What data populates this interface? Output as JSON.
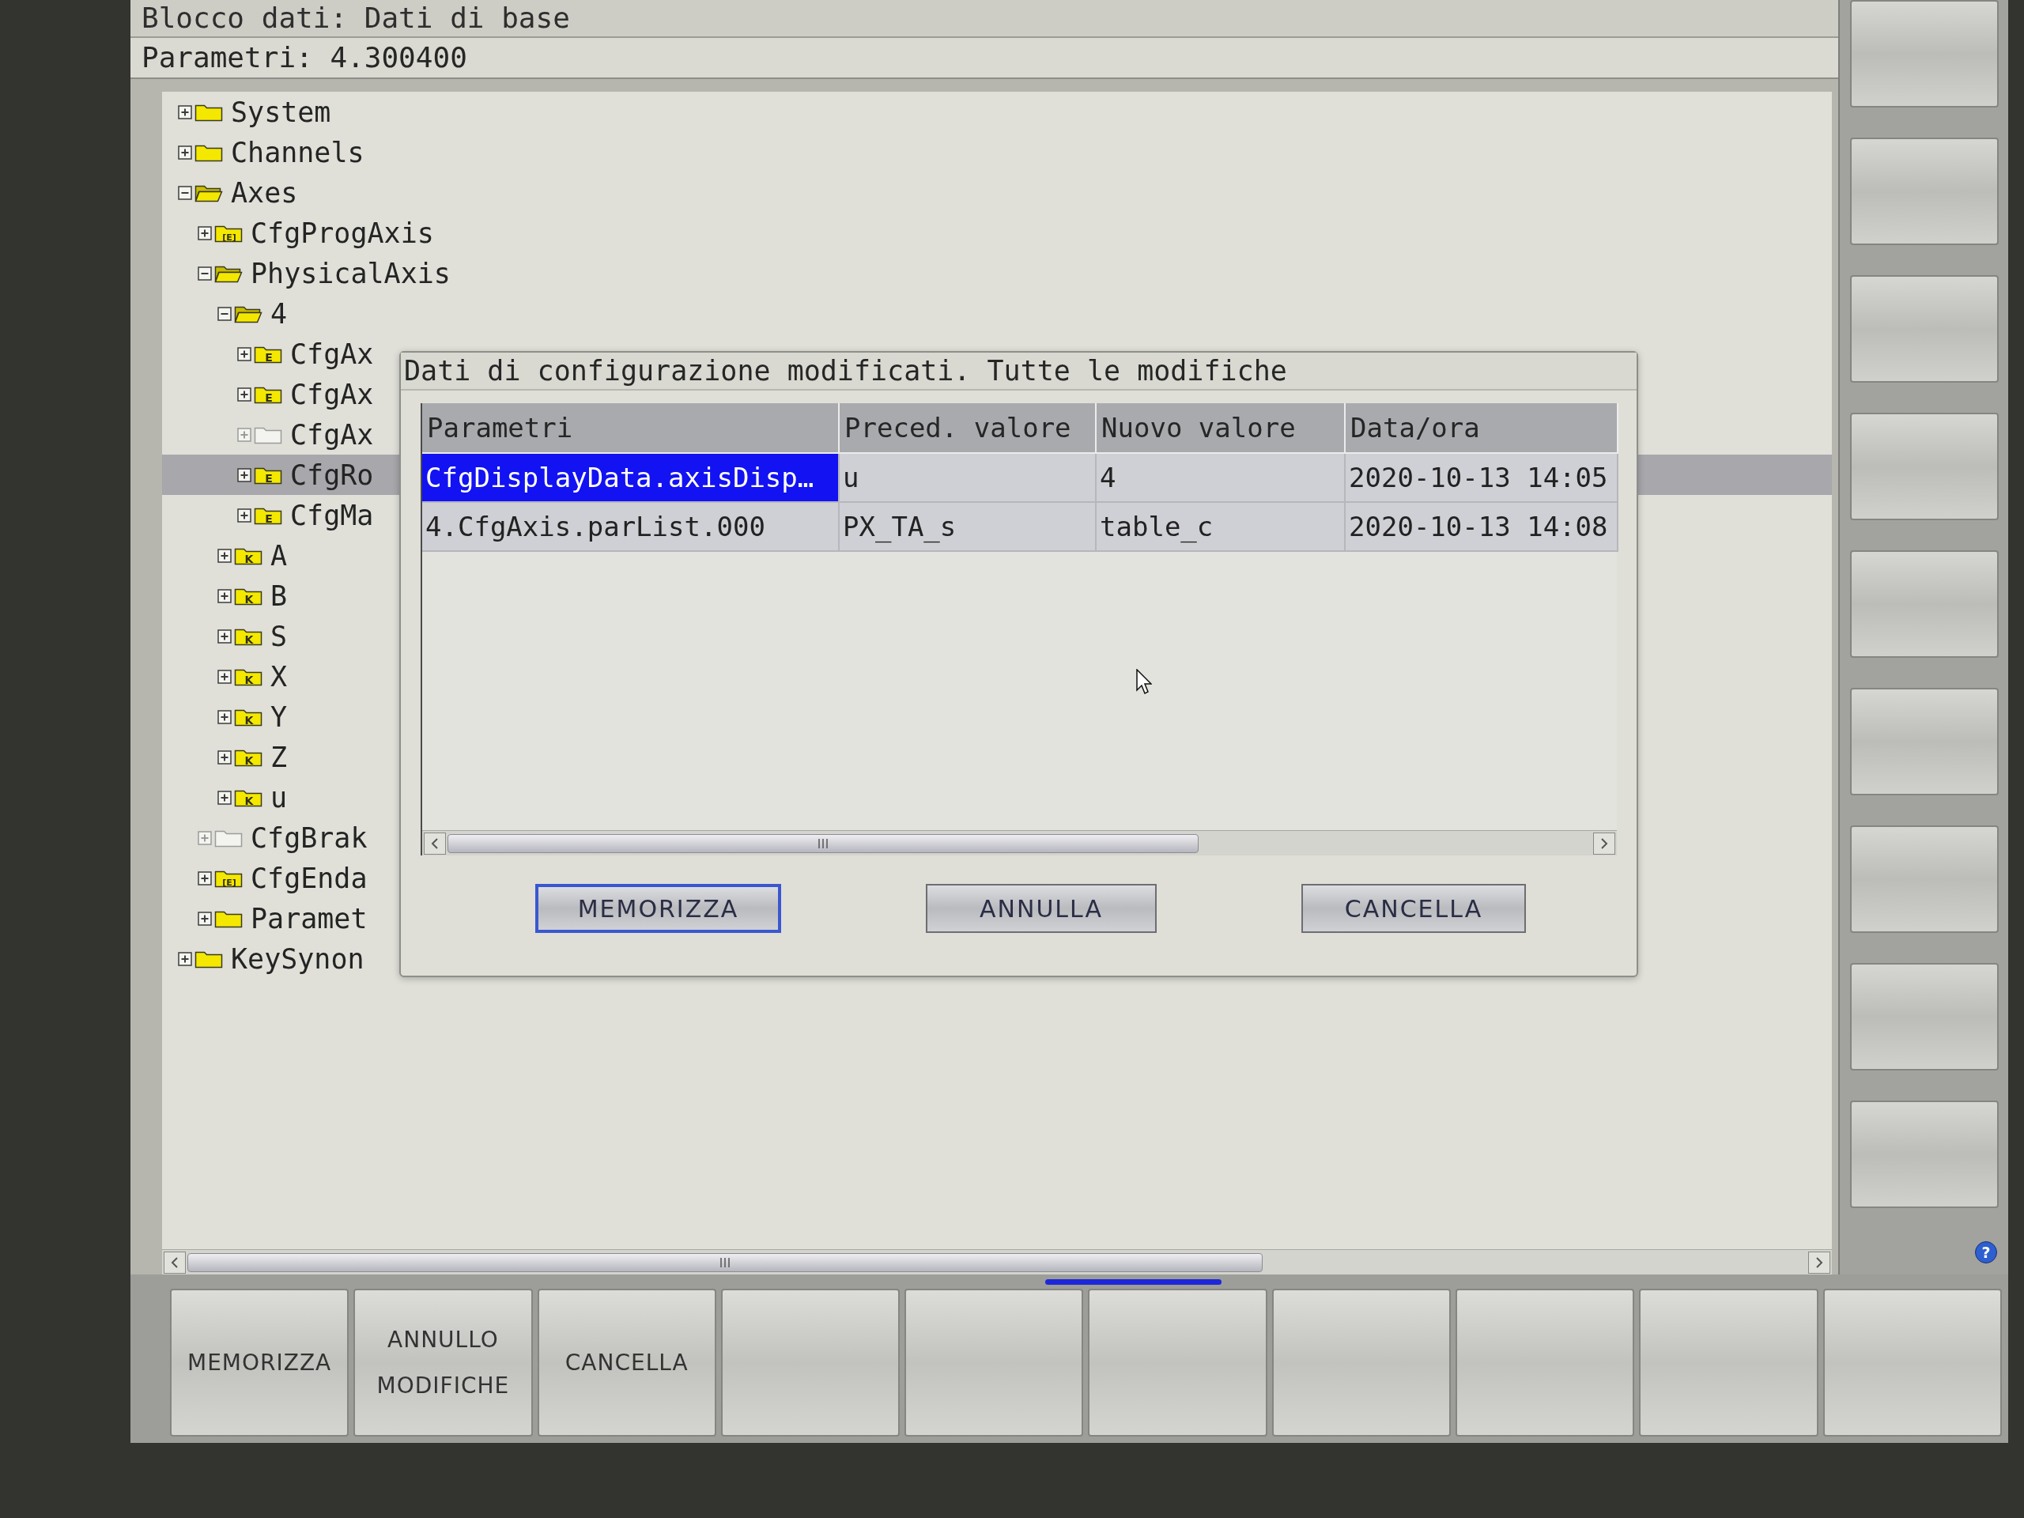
{
  "header": {
    "data_block": "Blocco dati: Dati di base",
    "parameters": "Parametri: 4.300400"
  },
  "tree": {
    "items": [
      {
        "label": "System",
        "kind": "folder",
        "expanded": false,
        "selected": false
      },
      {
        "label": "Channels",
        "kind": "folder",
        "expanded": false,
        "selected": false
      },
      {
        "label": "Axes",
        "kind": "folder",
        "expanded": true,
        "selected": false,
        "children": [
          {
            "label": "CfgProgAxis",
            "kind": "folder",
            "icon_letter": "[E]",
            "expanded": false,
            "selected": false
          },
          {
            "label": "PhysicalAxis",
            "kind": "folder",
            "expanded": true,
            "selected": false,
            "children": [
              {
                "label": "4",
                "kind": "folder",
                "expanded": true,
                "selected": false,
                "children": [
                  {
                    "label": "CfgAx",
                    "kind": "folder",
                    "icon_letter": "E",
                    "expanded": false,
                    "selected": false
                  },
                  {
                    "label": "CfgAx",
                    "kind": "folder",
                    "icon_letter": "E",
                    "expanded": false,
                    "selected": false
                  },
                  {
                    "label": "CfgAx",
                    "kind": "empty-folder",
                    "expanded": false,
                    "selected": false
                  },
                  {
                    "label": "CfgRo",
                    "kind": "folder",
                    "icon_letter": "E",
                    "expanded": false,
                    "selected": true
                  },
                  {
                    "label": "CfgMa",
                    "kind": "folder",
                    "icon_letter": "E",
                    "expanded": false,
                    "selected": false
                  }
                ]
              },
              {
                "label": "A",
                "kind": "folder",
                "icon_letter": "K",
                "expanded": false,
                "selected": false
              },
              {
                "label": "B",
                "kind": "folder",
                "icon_letter": "K",
                "expanded": false,
                "selected": false
              },
              {
                "label": "S",
                "kind": "folder",
                "icon_letter": "K",
                "expanded": false,
                "selected": false
              },
              {
                "label": "X",
                "kind": "folder",
                "icon_letter": "K",
                "expanded": false,
                "selected": false
              },
              {
                "label": "Y",
                "kind": "folder",
                "icon_letter": "K",
                "expanded": false,
                "selected": false
              },
              {
                "label": "Z",
                "kind": "folder",
                "icon_letter": "K",
                "expanded": false,
                "selected": false
              },
              {
                "label": "u",
                "kind": "folder",
                "icon_letter": "K",
                "expanded": false,
                "selected": false
              }
            ]
          },
          {
            "label": "CfgBrak",
            "kind": "empty-folder",
            "expanded": false,
            "selected": false
          },
          {
            "label": "CfgEnda",
            "kind": "folder",
            "icon_letter": "[E]",
            "expanded": false,
            "selected": false
          },
          {
            "label": "Paramet",
            "kind": "folder",
            "expanded": false,
            "selected": false
          }
        ]
      },
      {
        "label": "KeySynon",
        "kind": "folder",
        "expanded": false,
        "selected": false
      }
    ]
  },
  "dialog": {
    "title": "Dati di configurazione modificati. Tutte le modifiche",
    "table": {
      "columns": [
        "Parametri",
        "Preced. valore",
        "Nuovo valore",
        "Data/ora"
      ],
      "rows": [
        {
          "cells": [
            "CfgDisplayData.axisDisp…",
            "u",
            "4",
            "2020-10-13 14:05"
          ],
          "selected": true
        },
        {
          "cells": [
            "4.CfgAxis.parList.000",
            "PX_TA_s",
            "table_c",
            "2020-10-13 14:08"
          ],
          "selected": false
        }
      ]
    },
    "buttons": [
      {
        "label": "MEMORIZZA",
        "focused": true
      },
      {
        "label": "ANNULLA",
        "focused": false
      },
      {
        "label": "CANCELLA",
        "focused": false
      }
    ]
  },
  "side_softkeys": [
    {
      "kind": "blank"
    },
    {
      "kind": "blank"
    },
    {
      "kind": "blank"
    },
    {
      "kind": "blank"
    },
    {
      "kind": "blank"
    },
    {
      "kind": "blank"
    },
    {
      "kind": "blank"
    },
    {
      "kind": "blank"
    },
    {
      "kind": "blank"
    }
  ],
  "help_button": "?",
  "softkeys": [
    {
      "kind": "labeled",
      "label": "MEMORIZZA"
    },
    {
      "kind": "labeled",
      "label": "ANNULLO MODIFICHE"
    },
    {
      "kind": "labeled",
      "label": "CANCELLA"
    },
    {
      "kind": "blank"
    },
    {
      "kind": "blank"
    },
    {
      "kind": "blank"
    },
    {
      "kind": "blank"
    },
    {
      "kind": "blank"
    },
    {
      "kind": "blank"
    },
    {
      "kind": "blank"
    }
  ]
}
